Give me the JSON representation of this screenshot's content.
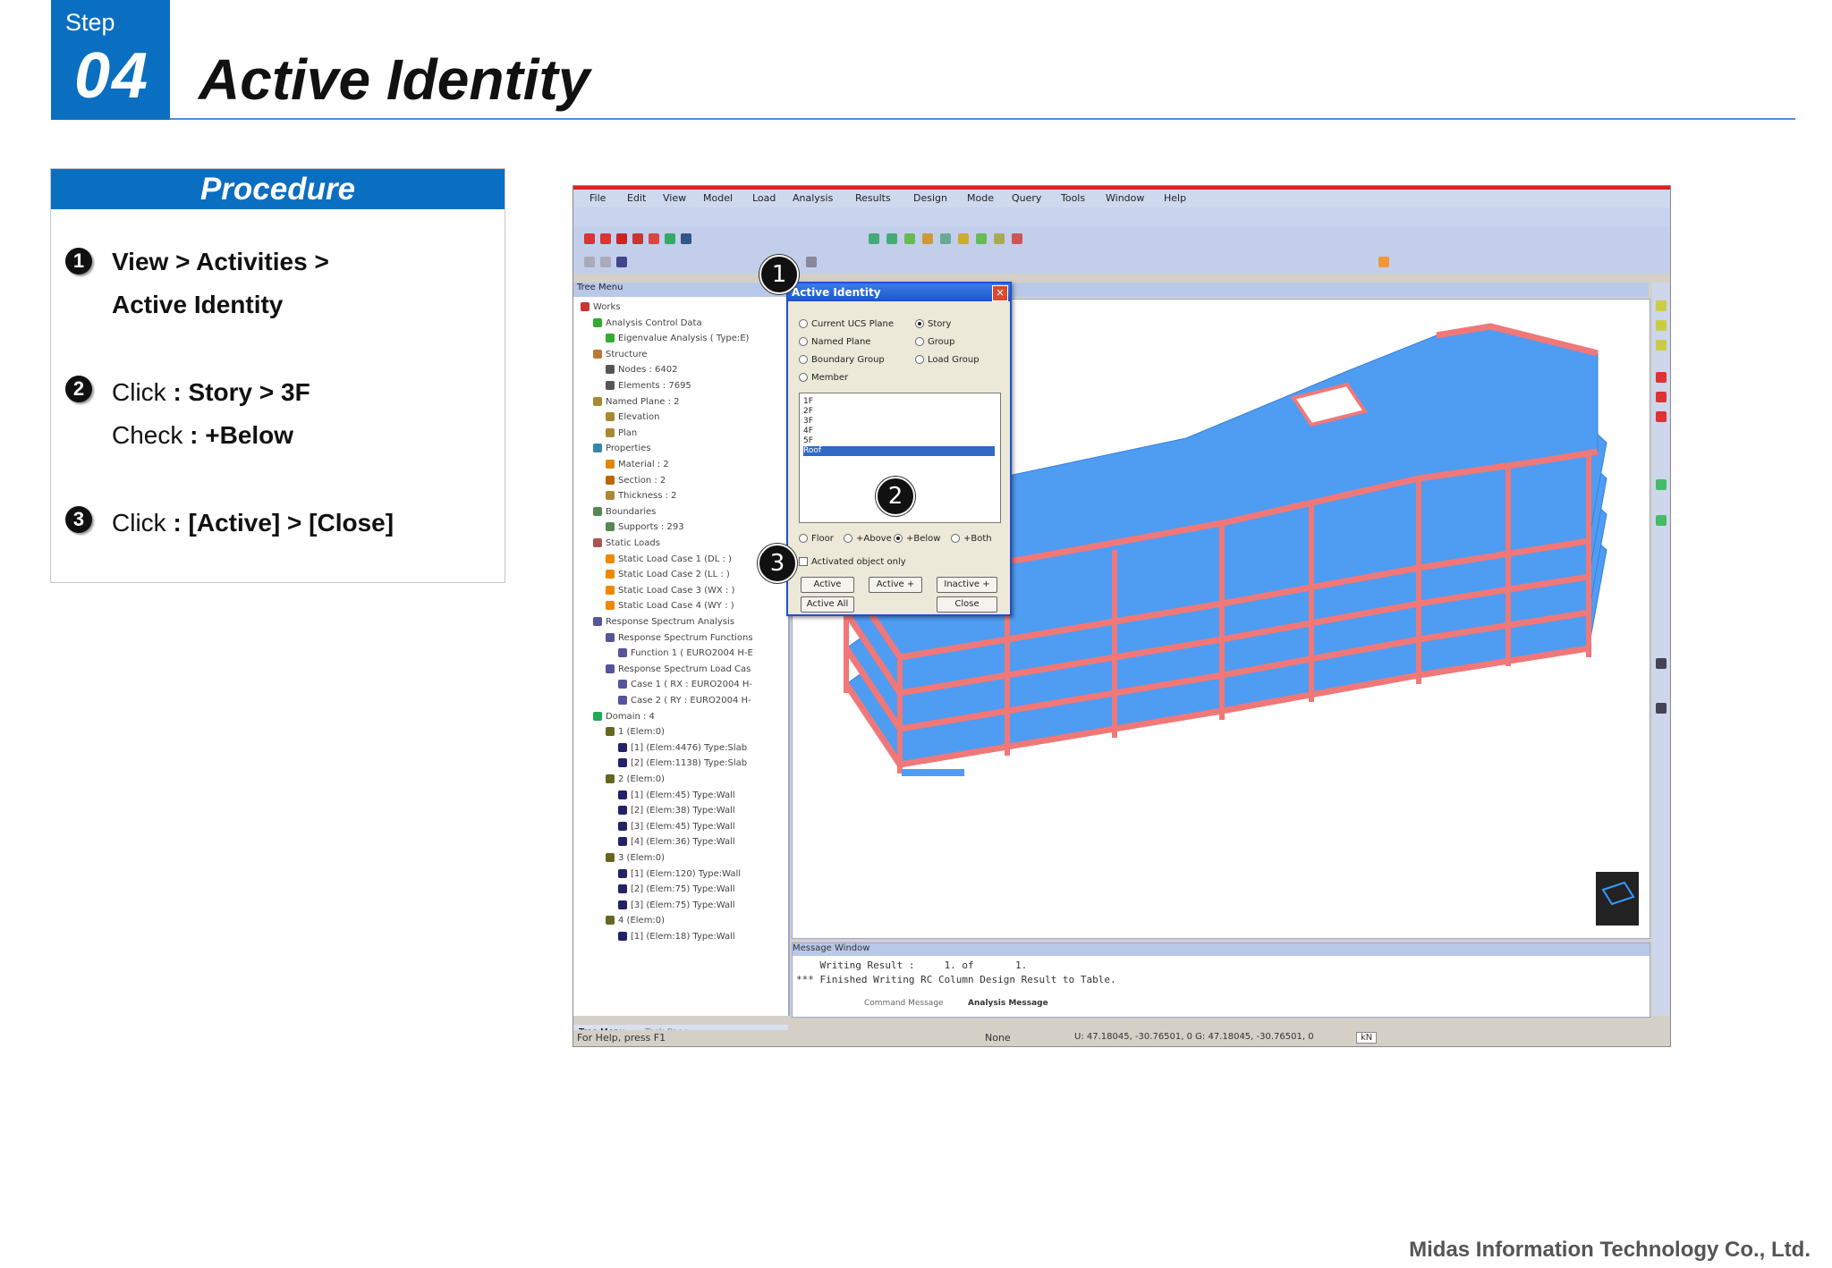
{
  "header": {
    "step_word": "Step",
    "step_number": "04",
    "title": "Active Identity"
  },
  "procedure": {
    "title": "Procedure",
    "steps": [
      {
        "number": "1",
        "line1_a": "View > Activities >",
        "line2_a": "Active Identity"
      },
      {
        "number": "2",
        "line1_a": "Click",
        "line1_b": " : Story  > 3F",
        "line2_a": "Check",
        "line2_b": " : +Below"
      },
      {
        "number": "3",
        "line1_a": "Click",
        "line1_b": " : [Active] > [Close]"
      }
    ]
  },
  "app": {
    "menu": [
      "File",
      "Edit",
      "View",
      "Model",
      "Load",
      "Analysis",
      "Results",
      "Design",
      "Mode",
      "Query",
      "Tools",
      "Window",
      "Help"
    ],
    "tree": {
      "title": "Tree Menu",
      "tabs": [
        "Tree Menu",
        "Task Pane"
      ],
      "rows": [
        "Works",
        "Analysis Control Data",
        "Eigenvalue Analysis ( Type:E)",
        "Structure",
        "Nodes : 6402",
        "Elements : 7695",
        "Named Plane : 2",
        "Elevation",
        "Plan",
        "Properties",
        "Material : 2",
        "Section : 2",
        "Thickness : 2",
        "Boundaries",
        "Supports : 293",
        "Static Loads",
        "Static Load Case 1 (DL : )",
        "Static Load Case 2 (LL : )",
        "Static Load Case 3 (WX : )",
        "Static Load Case 4 (WY : )",
        "Response Spectrum Analysis",
        "Response Spectrum Functions",
        "Function 1 ( EURO2004 H-E",
        "Response Spectrum Load Cas",
        "Case 1 ( RX : EURO2004 H-",
        "Case 2 ( RY : EURO2004 H-",
        "Domain : 4",
        "1 (Elem:0)",
        "[1] (Elem:4476) Type:Slab",
        "[2] (Elem:1138) Type:Slab",
        "2 (Elem:0)",
        "[1] (Elem:45) Type:Wall",
        "[2] (Elem:38) Type:Wall",
        "[3] (Elem:45) Type:Wall",
        "[4] (Elem:36) Type:Wall",
        "3 (Elem:0)",
        "[1] (Elem:120) Type:Wall",
        "[2] (Elem:75) Type:Wall",
        "[3] (Elem:75) Type:Wall",
        "4 (Elem:0)",
        "[1] (Elem:18) Type:Wall"
      ]
    },
    "dialog": {
      "title": "Active Identity",
      "options_left": [
        "Current UCS Plane",
        "Named Plane",
        "Boundary Group",
        "Member"
      ],
      "options_right": [
        "Story",
        "Group",
        "Load Group"
      ],
      "stories": [
        "1F",
        "2F",
        "3F",
        "4F",
        "5F",
        "Roof"
      ],
      "below_options": [
        "Floor",
        "+Above",
        "+Below",
        "+Both"
      ],
      "activated_only": "Activated object only",
      "buttons": {
        "active": "Active",
        "active_plus": "Active +",
        "inactive_plus": "Inactive +",
        "active_all": "Active All",
        "close": "Close"
      }
    },
    "message": {
      "title": "Message Window",
      "lines": [
        "    Writing Result :     1. of       1.",
        "*** Finished Writing RC Column Design Result to Table."
      ],
      "tabs": [
        "Command Message",
        "Analysis Message"
      ]
    },
    "status": {
      "help": "For Help, press F1",
      "none": "None",
      "coords": "U: 47.18045, -30.76501, 0   G: 47.18045, -30.76501, 0",
      "unit": "kN"
    },
    "callouts": [
      "1",
      "2",
      "3"
    ]
  },
  "footer": "Midas Information Technology Co., Ltd.",
  "colors": {
    "accent": "#0b6fc1",
    "slab": "#4f9cf3",
    "frame": "#f07878"
  }
}
